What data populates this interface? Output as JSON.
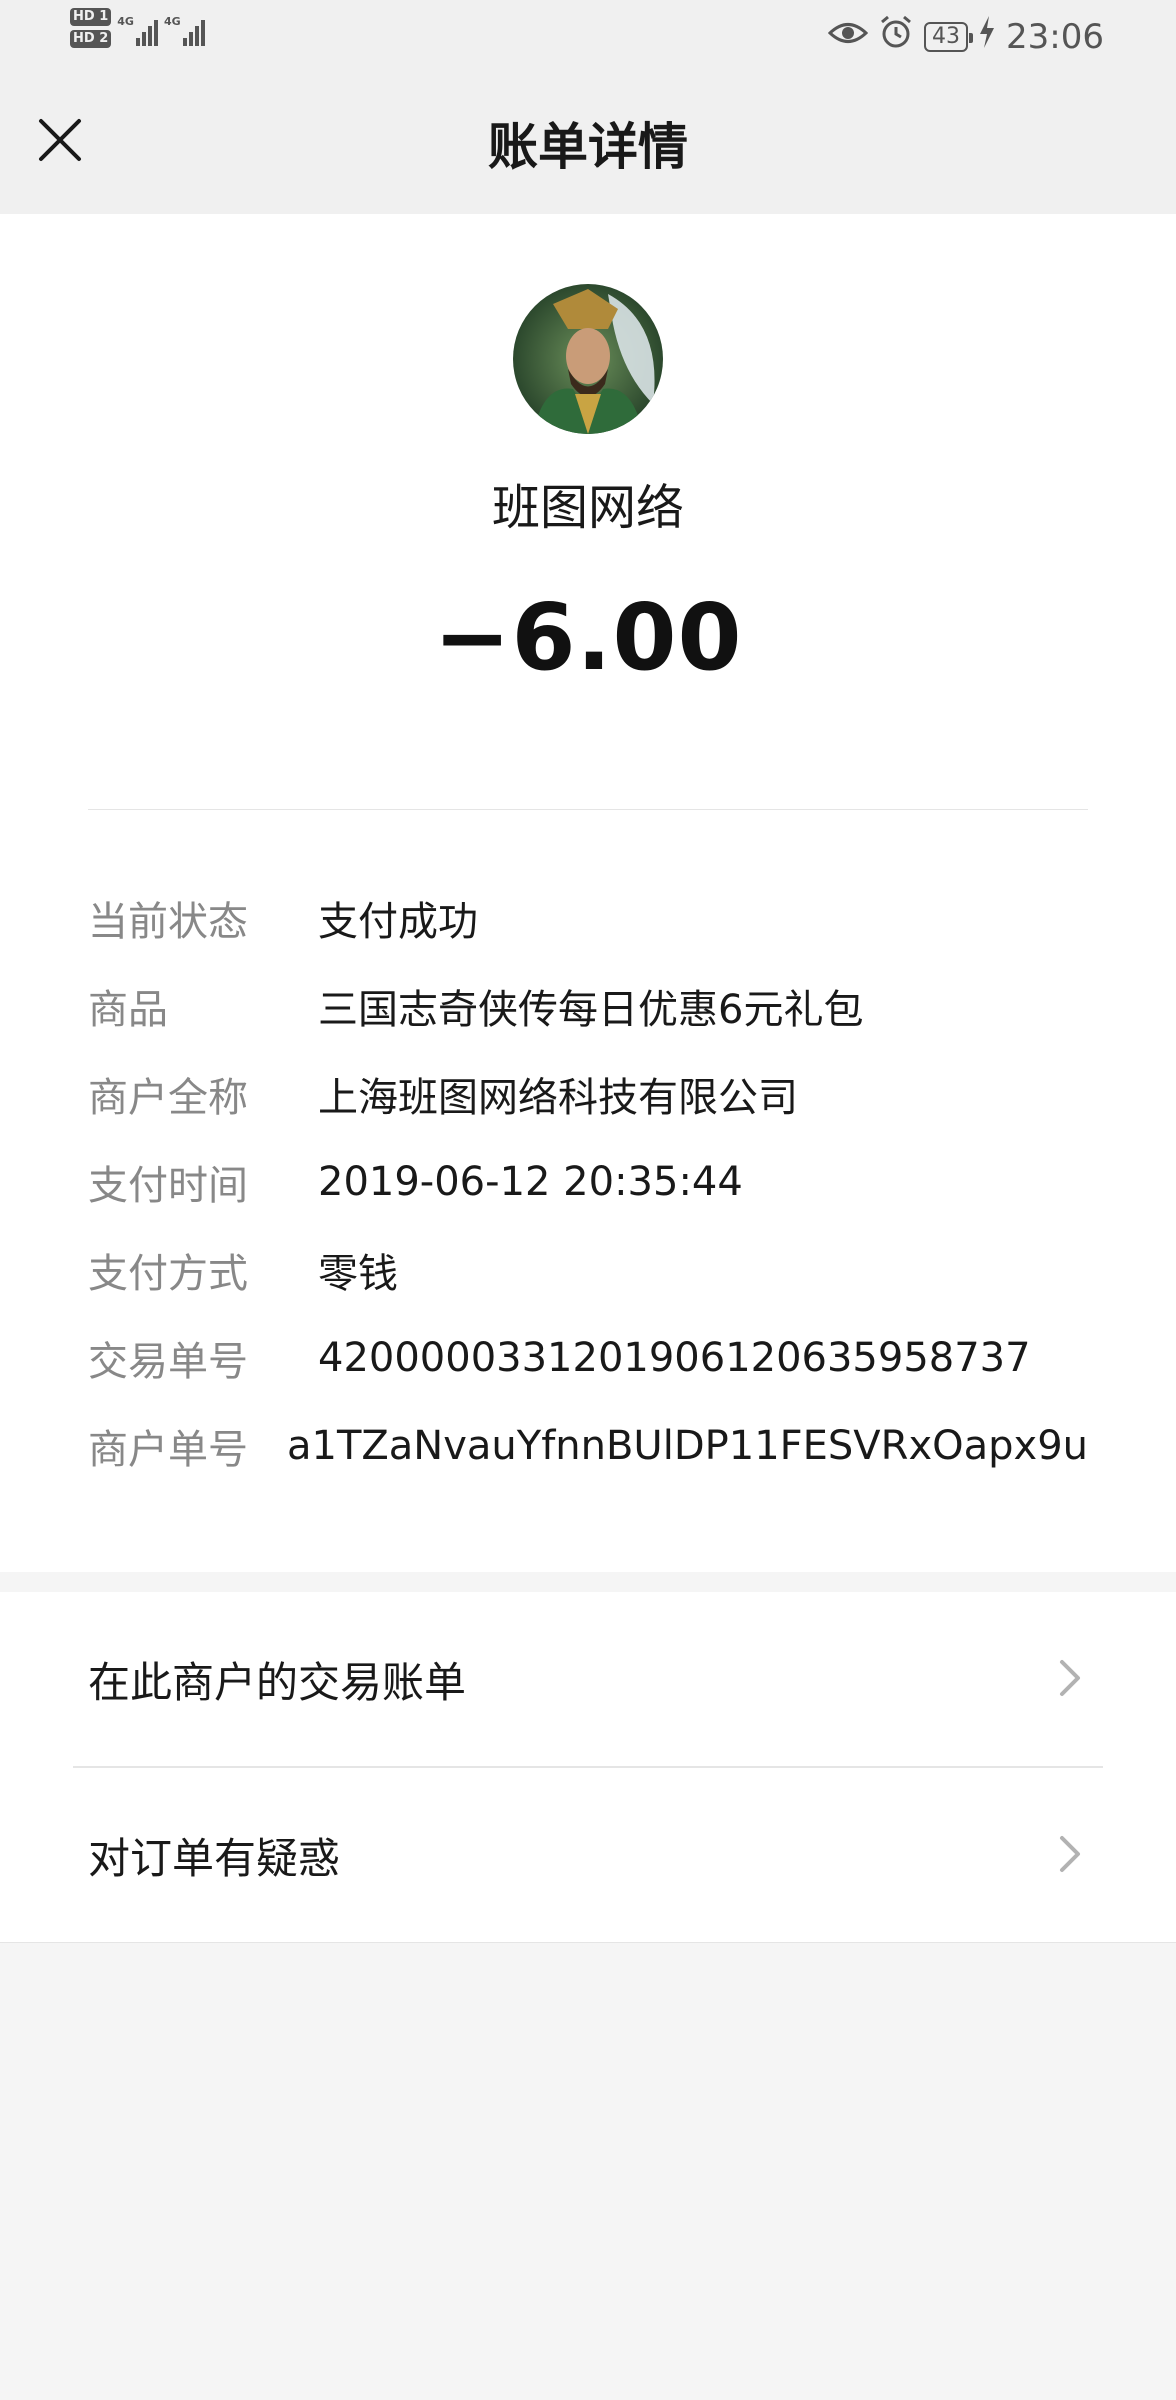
{
  "status_bar": {
    "hd1": "HD 1",
    "hd2": "HD 2",
    "sig1_label": "4G",
    "sig2_label": "4G",
    "battery": "43",
    "time": "23:06",
    "icons": [
      "eye-icon",
      "alarm-icon",
      "battery-icon",
      "charging-icon"
    ]
  },
  "header": {
    "title": "账单详情",
    "close_icon": "close-icon"
  },
  "merchant": {
    "name": "班图网络",
    "amount": "−6.00",
    "avatar": "avatar"
  },
  "details": [
    {
      "label": "当前状态",
      "value": "支付成功"
    },
    {
      "label": "商品",
      "value": "三国志奇侠传每日优惠6元礼包"
    },
    {
      "label": "商户全称",
      "value": "上海班图网络科技有限公司"
    },
    {
      "label": "支付时间",
      "value": "2019-06-12 20:35:44"
    },
    {
      "label": "支付方式",
      "value": "零钱"
    },
    {
      "label": "交易单号",
      "value": "4200000331201906120635958737"
    },
    {
      "label": "商户单号",
      "value": "a1TZaNvauYfnnBUlDP11FESVRxOapx9u"
    }
  ],
  "actions": [
    {
      "label": "在此商户的交易账单",
      "icon": "chevron-right-icon"
    },
    {
      "label": "对订单有疑惑",
      "icon": "chevron-right-icon"
    }
  ],
  "colors": {
    "header_bg": "#f0f0f0",
    "page_bg": "#f5f5f5",
    "card_bg": "#ffffff",
    "label_gray": "#888888",
    "text_dark": "#191919"
  }
}
